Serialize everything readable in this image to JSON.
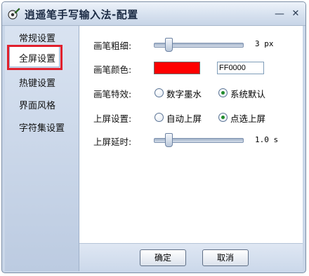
{
  "window": {
    "title": "逍遥笔手写输入法-配置",
    "min_glyph": "—",
    "close_glyph": "✕"
  },
  "sidebar": {
    "items": [
      {
        "label": "常规设置",
        "selected": false
      },
      {
        "label": "全屏设置",
        "selected": true
      },
      {
        "label": "热键设置",
        "selected": false
      },
      {
        "label": "界面风格",
        "selected": false
      },
      {
        "label": "字符集设置",
        "selected": false
      }
    ],
    "highlight_color": "#e1202d"
  },
  "content": {
    "stroke_width": {
      "label": "画笔粗细:",
      "value": "3 px",
      "slider_fraction": 0.13
    },
    "pen_color": {
      "label": "画笔颜色:",
      "swatch": "#ff0000",
      "hex_value": "FF0000"
    },
    "pen_effect": {
      "label": "画笔特效:",
      "options": [
        {
          "label": "数字墨水",
          "checked": false
        },
        {
          "label": "系统默认",
          "checked": true
        }
      ]
    },
    "commit_setting": {
      "label": "上屏设置:",
      "options": [
        {
          "label": "自动上屏",
          "checked": false
        },
        {
          "label": "点选上屏",
          "checked": true
        }
      ]
    },
    "commit_delay": {
      "label": "上屏延时:",
      "value": "1.0 s",
      "slider_fraction": 0.13
    }
  },
  "footer": {
    "ok_label": "确定",
    "cancel_label": "取消"
  }
}
